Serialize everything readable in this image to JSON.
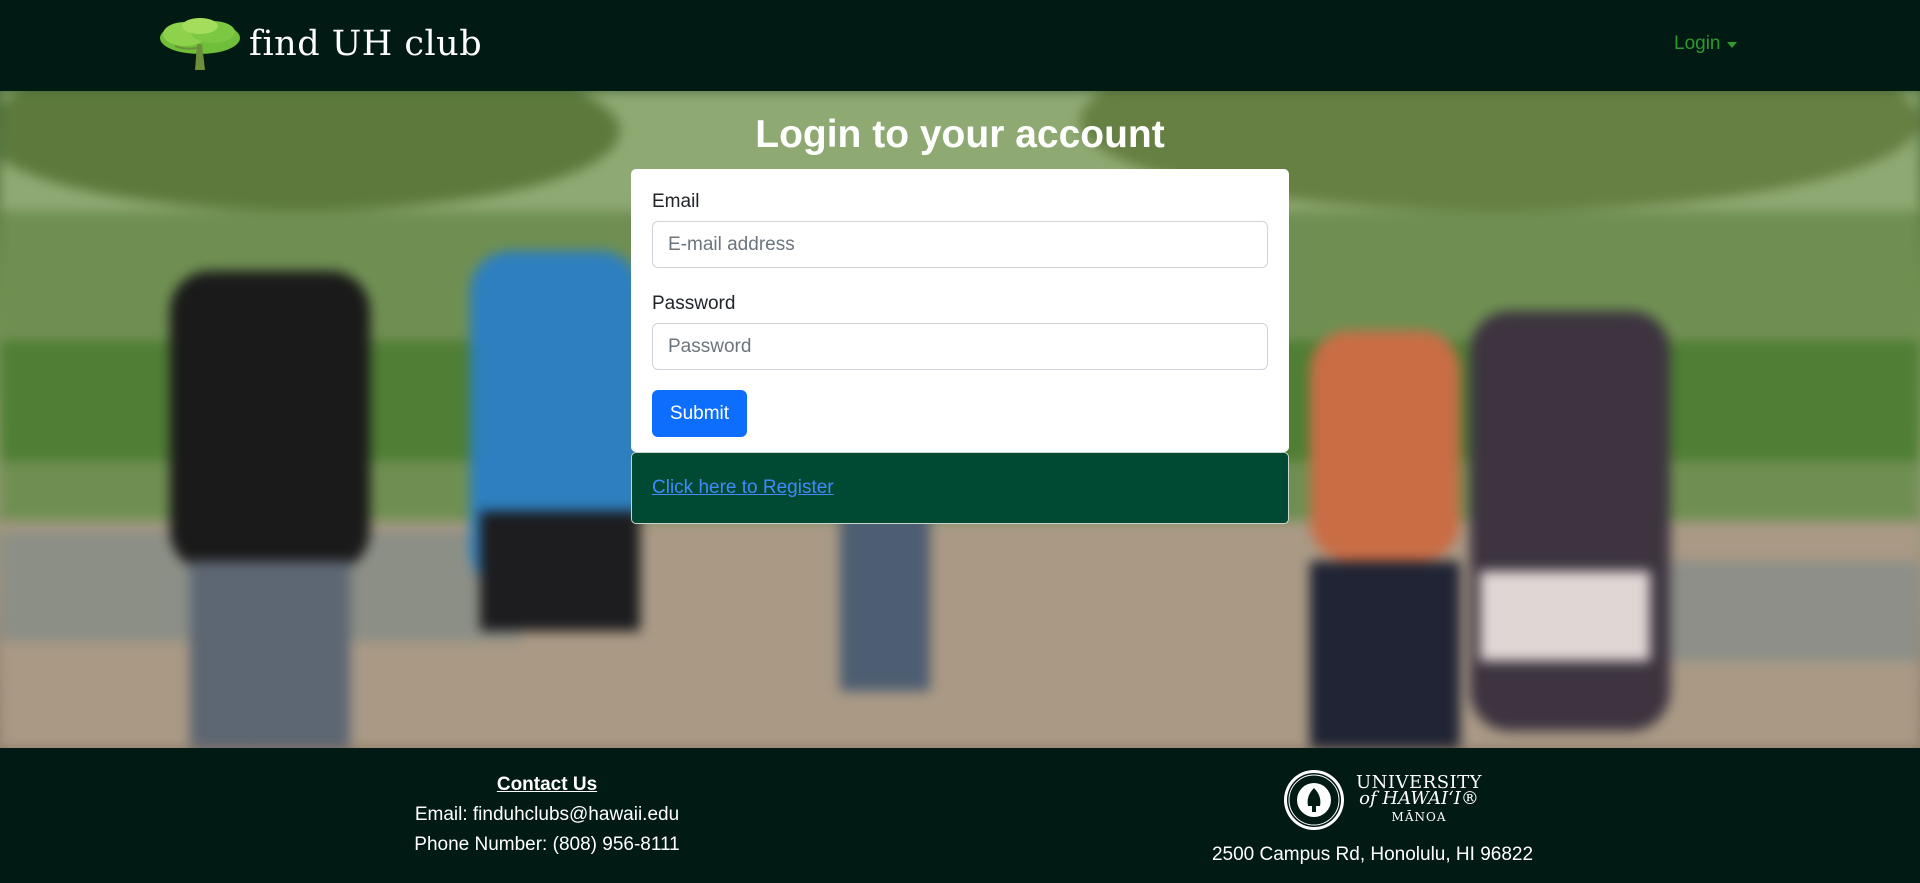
{
  "navbar": {
    "brand_text": "find UH club",
    "login_label": "Login",
    "logo_icon": "tree-icon"
  },
  "hero": {
    "title": "Login to your account"
  },
  "login_form": {
    "email_label": "Email",
    "email_placeholder": "E-mail address",
    "email_value": "",
    "password_label": "Password",
    "password_placeholder": "Password",
    "password_value": "",
    "submit_label": "Submit"
  },
  "register": {
    "link_text": "Click here to Register"
  },
  "footer": {
    "contact_heading": "Contact Us",
    "email_line": "Email: finduhclubs@hawaii.edu",
    "phone_line": "Phone Number: (808) 956-8111",
    "university_line1": "UNIVERSITY",
    "university_line2": "of HAWAI‘I®",
    "university_line3": "MĀNOA",
    "address": "2500 Campus Rd, Honolulu, HI 96822"
  },
  "colors": {
    "navbar_bg": "#021a14",
    "login_link": "#2e9a2e",
    "submit_bg": "#0d6efd",
    "register_bg": "#004a33",
    "register_link": "#3d8bfd"
  }
}
